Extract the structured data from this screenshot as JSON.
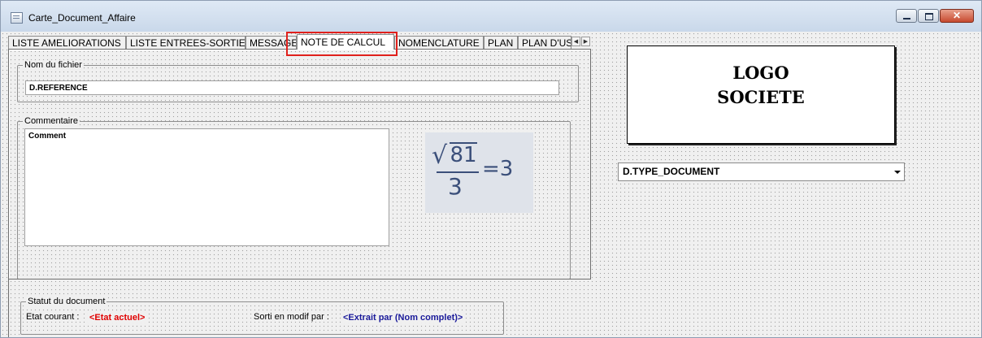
{
  "window": {
    "title": "Carte_Document_Affaire"
  },
  "tabs": [
    {
      "label": "LISTE AMELIORATIONS"
    },
    {
      "label": "LISTE ENTREES-SORTIES"
    },
    {
      "label": "MESSAGE"
    },
    {
      "label": "NOTE DE CALCUL",
      "active": true
    },
    {
      "label": "NOMENCLATURE"
    },
    {
      "label": "PLAN"
    },
    {
      "label": "PLAN D'USIN"
    }
  ],
  "nom_fichier": {
    "legend": "Nom du fichier",
    "value": "D.REFERENCE"
  },
  "commentaire": {
    "legend": "Commentaire",
    "value": "Comment"
  },
  "formula": {
    "numerator": "81",
    "denominator": "3",
    "result": "=3"
  },
  "logo": {
    "line1": "LOGO",
    "line2": "SOCIETE"
  },
  "type_document": {
    "value": "D.TYPE_DOCUMENT"
  },
  "statut": {
    "legend": "Statut du document",
    "etat_label": "Etat courant :",
    "etat_value": "<Etat actuel>",
    "sorti_label": "Sorti en modif par :",
    "sorti_value": "<Extrait par (Nom complet)>"
  },
  "colors": {
    "highlight": "#e0201c",
    "etat": "#e00000",
    "sorti": "#1a1a9a"
  },
  "icons": [
    "form-icon",
    "minimize-icon",
    "maximize-icon",
    "close-icon",
    "tab-scroll-left-icon",
    "tab-scroll-right-icon",
    "dropdown-arrow-icon"
  ]
}
